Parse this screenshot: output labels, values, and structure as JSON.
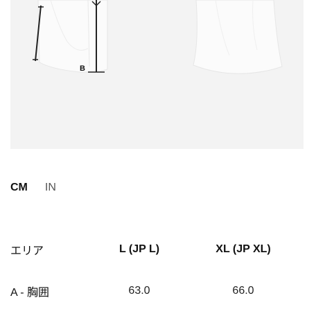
{
  "figure": {
    "marker_letter": "B"
  },
  "unit_toggle": {
    "active": "CM",
    "inactive": "IN"
  },
  "size_table": {
    "headers": [
      "エリア",
      "L (JP L)",
      "XL (JP XL)"
    ],
    "rows": [
      {
        "label": "A - 胸囲",
        "values": [
          "63.0",
          "66.0"
        ]
      }
    ]
  }
}
